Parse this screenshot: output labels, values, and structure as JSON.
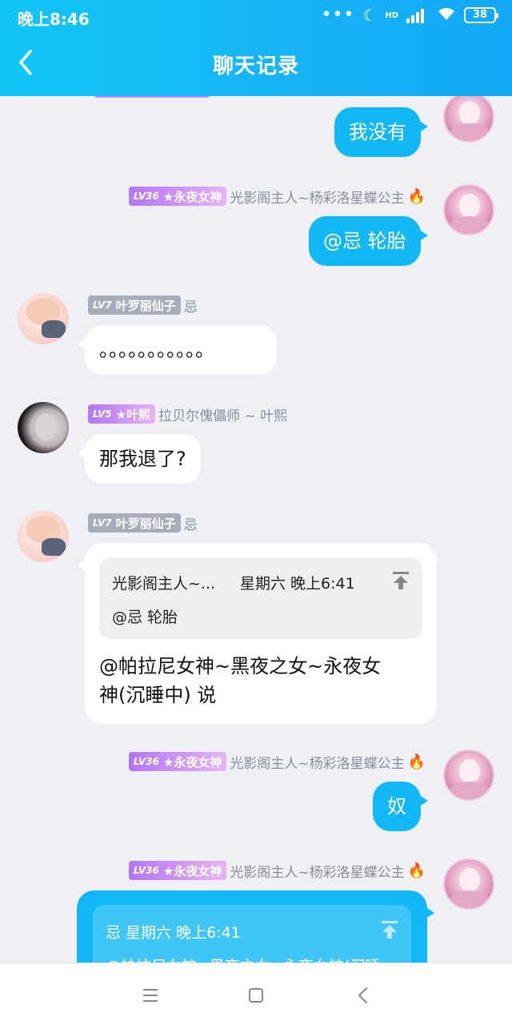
{
  "status": {
    "time": "晚上8:46",
    "dots": "•••",
    "network": "HD",
    "battery": "38"
  },
  "header": {
    "title": "聊天记录"
  },
  "messages": {
    "m1": {
      "text": "我没有"
    },
    "m2": {
      "level": "LV36",
      "title": "★永夜女神",
      "name": "光影阁主人~杨彩洛星蝶公主",
      "text": "@忌 轮胎"
    },
    "m3": {
      "level": "LV7",
      "title": "叶罗丽仙子",
      "name": "忌",
      "text": "。。。。。。。。。。。"
    },
    "m4": {
      "level": "LV5",
      "title": "★叶熙",
      "name": "拉贝尔傀儡师 ~ 叶熙",
      "text": "那我退了?"
    },
    "m5": {
      "level": "LV7",
      "title": "叶罗丽仙子",
      "name": "忌",
      "quote_sender": "光影阁主人~...",
      "quote_time": "星期六 晚上6:41",
      "quote_text": "@忌 轮胎",
      "text_line1": "@帕拉尼女神~黑夜之女~永夜女",
      "text_line2": "神(沉睡中) 说"
    },
    "m6": {
      "level": "LV36",
      "title": "★永夜女神",
      "name": "光影阁主人~杨彩洛星蝶公主",
      "text": "奴"
    },
    "m7": {
      "level": "LV36",
      "title": "★永夜女神",
      "name": "光影阁主人~杨彩洛星蝶公主",
      "quote_head": "忌 星期六 晚上6:41",
      "quote_text": "@帕拉尼女神~黑夜之女~永夜女神(沉睡"
    }
  },
  "colors": {
    "accent": "#12b7f5",
    "badge_purple": "#b277f3",
    "badge_grey": "#a7adbb",
    "background": "#eef0f5"
  },
  "icons": {
    "back": "chevron-left-icon",
    "fire": "fire-icon",
    "jump": "jump-to-top-icon"
  },
  "glyphs": {
    "fire": "🔥"
  }
}
